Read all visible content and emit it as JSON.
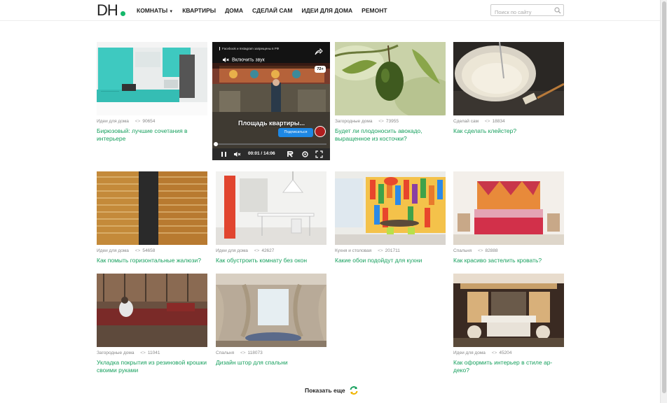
{
  "header": {
    "logo": "DH",
    "nav": [
      {
        "label": "КОМНАТЫ",
        "has_dropdown": true
      },
      {
        "label": "КВАРТИРЫ",
        "has_dropdown": false
      },
      {
        "label": "ДОМА",
        "has_dropdown": false
      },
      {
        "label": "СДЕЛАЙ САМ",
        "has_dropdown": false
      },
      {
        "label": "ИДЕИ ДЛЯ ДОМА",
        "has_dropdown": false
      },
      {
        "label": "РЕМОНТ",
        "has_dropdown": false
      }
    ],
    "search_placeholder": "Поиск по сайту"
  },
  "video": {
    "notice": "Facebook и Instagram запрещены в РФ",
    "sound_label": "Включить звук",
    "age_badge": "72+",
    "overlay_title": "Площадь квартиры...",
    "subscribe_label": "Подписаться",
    "time": "00:01 / 14:06",
    "progress": 0.002
  },
  "cards": [
    {
      "category": "Идеи для дома",
      "views": "90654",
      "title": "Бирюзовый: лучшие сочетания в интерьере"
    },
    {
      "category": "Загородные дома",
      "views": "73955",
      "title": "Будет ли плодоносить авокадо, выращенное из косточки?"
    },
    {
      "category": "Сделай сам",
      "views": "18834",
      "title": "Как сделать клейстер?"
    },
    {
      "category": "Идеи для дома",
      "views": "54658",
      "title": "Как помыть горизонтальные жалюзи?"
    },
    {
      "category": "Идеи для дома",
      "views": "42627",
      "title": "Как обустроить комнату без окон"
    },
    {
      "category": "Кухня и столовая",
      "views": "201711",
      "title": "Какие обои подойдут для кухни"
    },
    {
      "category": "Спальня",
      "views": "82888",
      "title": "Как красиво застелить кровать?"
    },
    {
      "category": "Загородные дома",
      "views": "11041",
      "title": "Укладка покрытия из резиновой крошки своими руками"
    },
    {
      "category": "Спальня",
      "views": "118073",
      "title": "Дизайн штор для спальни"
    },
    {
      "category": "Идеи для дома",
      "views": "45204",
      "title": "Как оформить интерьер в стиле ар-деко?"
    }
  ],
  "show_more_label": "Показать еще",
  "colors": {
    "accent": "#17a05e",
    "logo_dot": "#15b86b",
    "subscribe": "#1e88e5"
  }
}
